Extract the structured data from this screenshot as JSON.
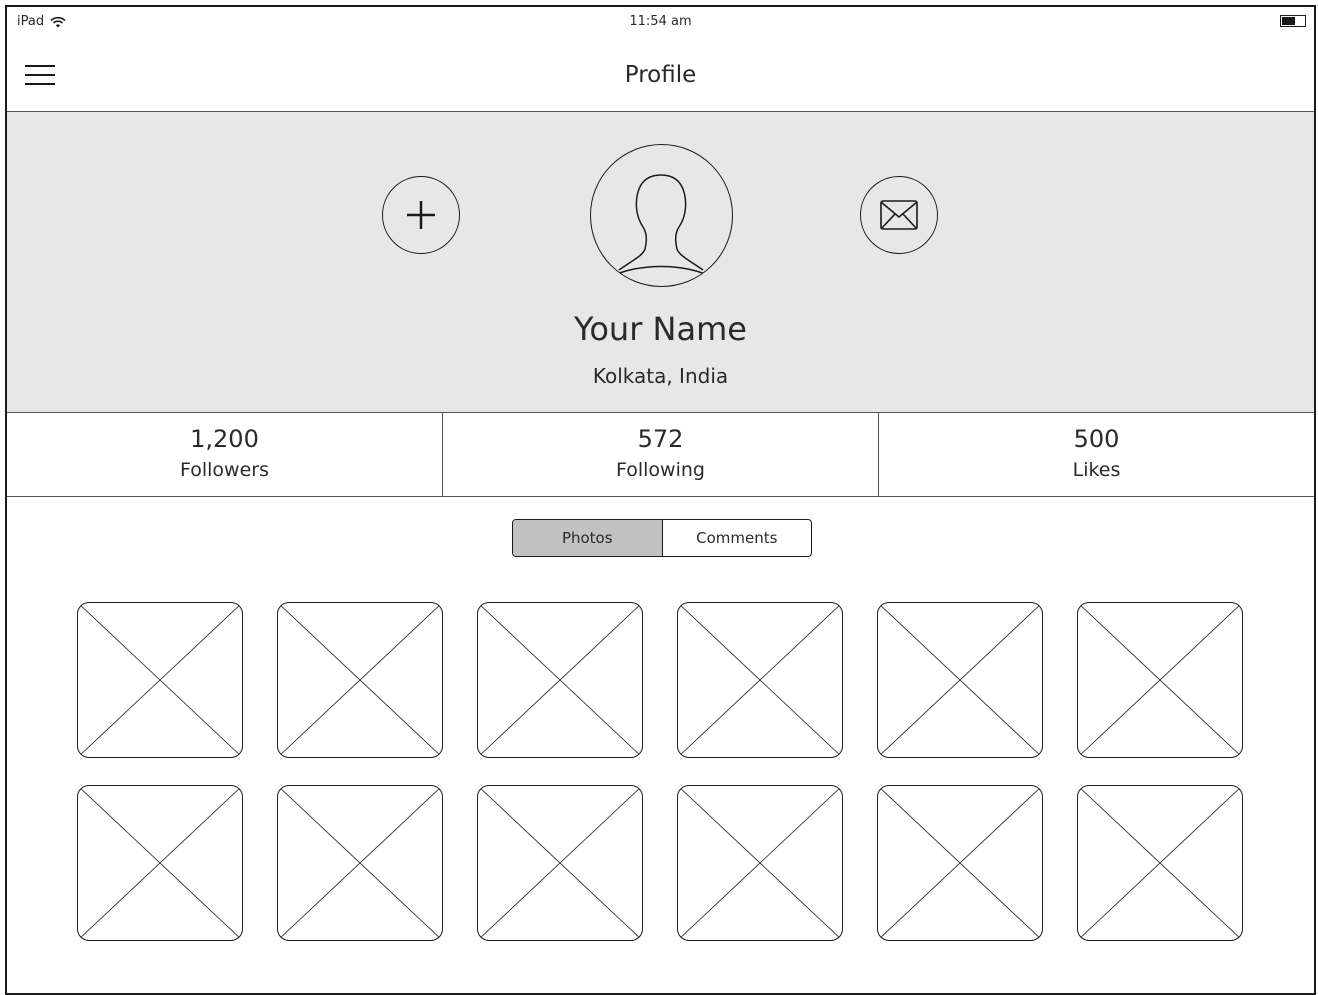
{
  "status_bar": {
    "device": "iPad",
    "time": "11:54 am",
    "wifi_icon": "wifi-icon",
    "battery_icon": "battery-icon",
    "battery_level": 0.6
  },
  "nav": {
    "title": "Profile",
    "menu_icon": "hamburger-menu-icon"
  },
  "profile": {
    "name": "Your Name",
    "location": "Kolkata, India",
    "add_icon": "plus-icon",
    "message_icon": "envelope-icon",
    "avatar_icon": "user-avatar-icon",
    "hero_background": "#e7e7e7"
  },
  "stats": [
    {
      "value": "1,200",
      "label": "Followers"
    },
    {
      "value": "572",
      "label": "Following"
    },
    {
      "value": "500",
      "label": "Likes"
    }
  ],
  "tabs": [
    {
      "label": "Photos",
      "active": true
    },
    {
      "label": "Comments",
      "active": false
    }
  ],
  "photos": {
    "placeholder_icon": "image-placeholder-icon",
    "count": 12
  }
}
